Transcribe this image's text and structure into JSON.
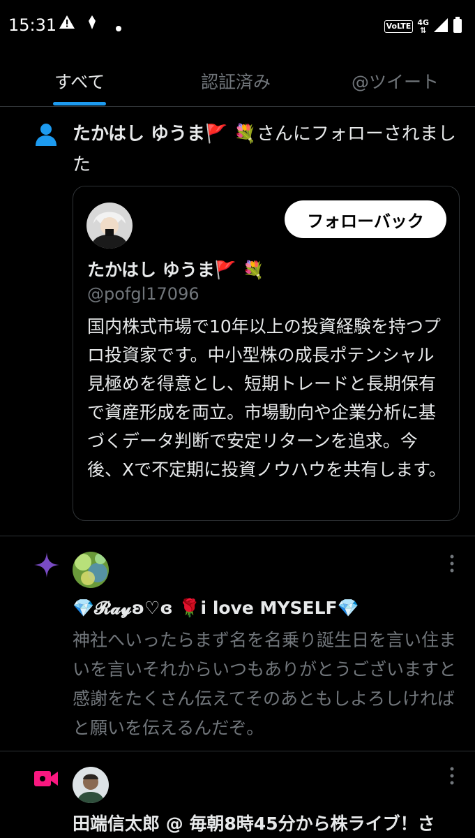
{
  "status_bar": {
    "time": "15:31",
    "left_icons": [
      "warning-icon",
      "location-icon",
      "dot-icon"
    ],
    "volte": "VoLTE",
    "network": "4G",
    "right_icons": [
      "signal-icon",
      "battery-icon"
    ]
  },
  "tabs": [
    {
      "label": "すべて",
      "active": true
    },
    {
      "label": "認証済み",
      "active": false
    },
    {
      "label": "@ツイート",
      "active": false
    }
  ],
  "accent_color": "#1d9bf0",
  "notifications": {
    "follow": {
      "icon": "person-icon",
      "user_name": "たかはし ゆうま🚩 💐",
      "suffix": "さんにフォローされました",
      "card": {
        "follow_back_label": "フォローバック",
        "name": "たかはし ゆうま🚩 💐",
        "handle": "@pofgl17096",
        "bio": "国内株式市場で10年以上の投資経験を持つプロ投資家です。中小型株の成長ポテンシャル見極めを得意とし、短期トレードと長期保有で資産形成を両立。市場動向や企業分析に基づくデータ判断で安定リターンを追求。今後、Xで不定期に投資ノウハウを共有します。"
      }
    },
    "recommended": {
      "icon": "sparkle-icon",
      "name": "💎𝓡𝓪𝔂ʚ♡ɞ 🌹i love MYSELF💎",
      "text": "神社へいったらまず名を名乗り誕生日を言い住まいを言いそれからいつもありがとうございますと感謝をたくさん伝えてそのあともしよろしければと願いを伝えるんだぞ。"
    },
    "live": {
      "icon": "video-icon",
      "name": "田端信太郎 @ 毎朝8時45分から株ライブ！さ"
    }
  }
}
